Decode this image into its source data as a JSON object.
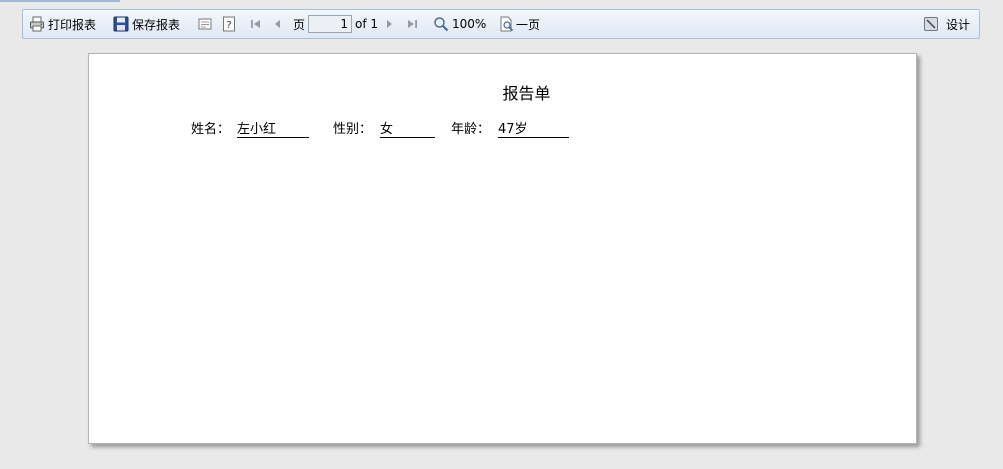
{
  "toolbar": {
    "print_label": "打印报表",
    "save_label": "保存报表",
    "page_label": "页",
    "page_current": "1",
    "page_total": "of 1",
    "zoom": "100%",
    "one_page_label": "一页",
    "design_label": "设计"
  },
  "report": {
    "title": "报告单",
    "fields": [
      {
        "label": "姓名：",
        "value": "左小红"
      },
      {
        "label": "性别：",
        "value": "女"
      },
      {
        "label": "年龄：",
        "value": "47岁"
      }
    ]
  }
}
